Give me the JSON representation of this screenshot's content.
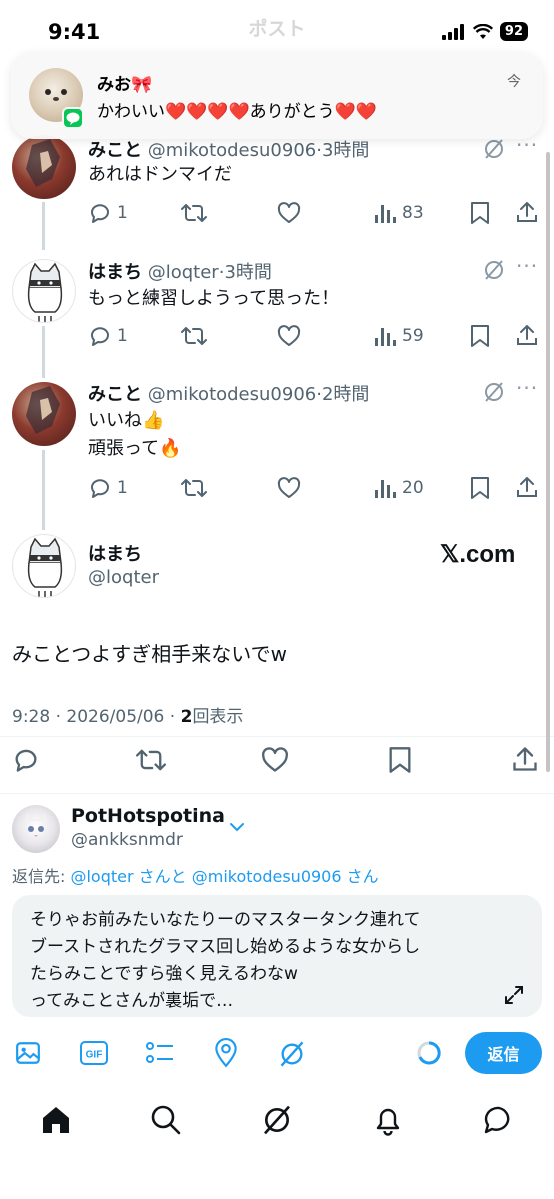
{
  "status_bar": {
    "time": "9:41",
    "battery": "92"
  },
  "header": {
    "title": "ポスト"
  },
  "notification": {
    "name": "みお🎀",
    "message": "かわいい❤️❤️❤️❤️ありがとう❤️❤️",
    "time": "今"
  },
  "thread": [
    {
      "name": "みこと",
      "handle": "@mikotodesu0906",
      "time": "3時間",
      "text": "あれはドンマイだ",
      "replies": "1",
      "views": "83"
    },
    {
      "name": "はまち",
      "handle": "@loqter",
      "time": "3時間",
      "text": "もっと練習しようって思った！",
      "replies": "1",
      "views": "59"
    },
    {
      "name": "みこと",
      "handle": "@mikotodesu0906",
      "time": "2時間",
      "text_line1": "いいね👍",
      "text_line2": "頑張って🔥",
      "replies": "1",
      "views": "20"
    }
  ],
  "main_post": {
    "name": "はまち",
    "handle": "@loqter",
    "source": "𝕏.com",
    "text": "みことつよすぎ相手来ないでw",
    "date": "9:28 · 2026/05/06 · ",
    "views_count": "2",
    "views_label": "回表示"
  },
  "composer": {
    "account_name": "PotHotspotina",
    "account_handle": "@ankksnmdr",
    "reply_prefix": "返信先: ",
    "reply_user1": "@loqter",
    "reply_mid": " さんと ",
    "reply_user2": "@mikotodesu0906",
    "reply_suffix": " さん",
    "draft_line1": "そりゃお前みたいなたりーのマスタータンク連れて",
    "draft_line2": "ブーストされたグラマス回し始めるような女からし",
    "draft_line3": "たらみことですら強く見えるわなw",
    "draft_line4": "ってみことさんが裏垢で…",
    "reply_button": "返信"
  },
  "colors": {
    "accent": "#1d9bf0",
    "muted": "#536471",
    "line_green": "#06c755"
  },
  "icons": [
    "reply-icon",
    "repost-icon",
    "like-icon",
    "views-icon",
    "bookmark-icon",
    "share-icon",
    "grok-icon",
    "image-icon",
    "gif-icon",
    "poll-icon",
    "location-icon",
    "home-icon",
    "search-icon",
    "bell-icon",
    "messages-icon"
  ]
}
